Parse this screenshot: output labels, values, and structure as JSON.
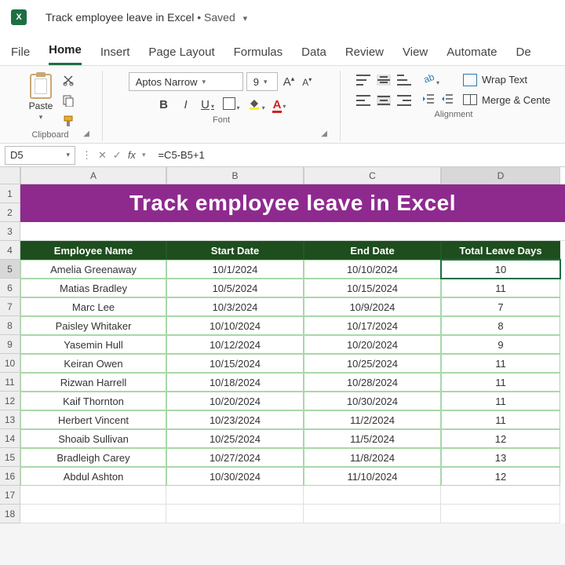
{
  "app": {
    "icon_text": "X",
    "doc_title": "Track employee leave in Excel",
    "save_status": "Saved"
  },
  "menu": {
    "file": "File",
    "home": "Home",
    "insert": "Insert",
    "page_layout": "Page Layout",
    "formulas": "Formulas",
    "data": "Data",
    "review": "Review",
    "view": "View",
    "automate": "Automate",
    "developer": "De"
  },
  "ribbon": {
    "clipboard": {
      "paste": "Paste",
      "label": "Clipboard"
    },
    "font": {
      "name": "Aptos Narrow",
      "size": "9",
      "label": "Font",
      "bold": "B",
      "italic": "I",
      "underline": "U",
      "color_letter": "A"
    },
    "alignment": {
      "wrap": "Wrap Text",
      "merge": "Merge & Cente",
      "label": "Alignment"
    }
  },
  "formula_bar": {
    "cell_ref": "D5",
    "fx": "fx",
    "formula": "=C5-B5+1"
  },
  "sheet": {
    "col_letters": [
      "A",
      "B",
      "C",
      "D"
    ],
    "title_banner": "Track employee leave in Excel",
    "headers": [
      "Employee Name",
      "Start Date",
      "End Date",
      "Total Leave Days"
    ],
    "rows": [
      {
        "name": "Amelia Greenaway",
        "start": "10/1/2024",
        "end": "10/10/2024",
        "days": "10"
      },
      {
        "name": "Matias Bradley",
        "start": "10/5/2024",
        "end": "10/15/2024",
        "days": "11"
      },
      {
        "name": "Marc Lee",
        "start": "10/3/2024",
        "end": "10/9/2024",
        "days": "7"
      },
      {
        "name": "Paisley Whitaker",
        "start": "10/10/2024",
        "end": "10/17/2024",
        "days": "8"
      },
      {
        "name": "Yasemin Hull",
        "start": "10/12/2024",
        "end": "10/20/2024",
        "days": "9"
      },
      {
        "name": "Keiran Owen",
        "start": "10/15/2024",
        "end": "10/25/2024",
        "days": "11"
      },
      {
        "name": "Rizwan Harrell",
        "start": "10/18/2024",
        "end": "10/28/2024",
        "days": "11"
      },
      {
        "name": "Kaif Thornton",
        "start": "10/20/2024",
        "end": "10/30/2024",
        "days": "11"
      },
      {
        "name": "Herbert Vincent",
        "start": "10/23/2024",
        "end": "11/2/2024",
        "days": "11"
      },
      {
        "name": "Shoaib Sullivan",
        "start": "10/25/2024",
        "end": "11/5/2024",
        "days": "12"
      },
      {
        "name": "Bradleigh Carey",
        "start": "10/27/2024",
        "end": "11/8/2024",
        "days": "13"
      },
      {
        "name": "Abdul Ashton",
        "start": "10/30/2024",
        "end": "11/10/2024",
        "days": "12"
      }
    ],
    "row_numbers": [
      "1",
      "2",
      "3",
      "4",
      "5",
      "6",
      "7",
      "8",
      "9",
      "10",
      "11",
      "12",
      "13",
      "14",
      "15",
      "16",
      "17",
      "18"
    ],
    "selected_row": "5",
    "selected_col": "D"
  }
}
